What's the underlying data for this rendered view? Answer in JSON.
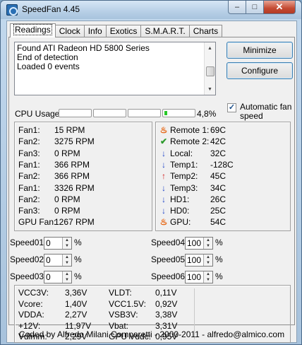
{
  "window": {
    "title": "SpeedFan 4.45",
    "min": "–",
    "max": "□",
    "close": "✕"
  },
  "tabs": [
    "Readings",
    "Clock",
    "Info",
    "Exotics",
    "S.M.A.R.T.",
    "Charts"
  ],
  "log": {
    "lines": [
      "Found ATI Radeon HD 5800 Series",
      "End of detection",
      "Loaded 0 events"
    ]
  },
  "buttons": {
    "minimize": "Minimize",
    "configure": "Configure"
  },
  "auto_fan": {
    "label": "Automatic fan speed",
    "checked": true,
    "mark": "✓"
  },
  "cpu_usage": {
    "label": "CPU Usage",
    "value": "4,8%",
    "fill_fraction": 0.048
  },
  "fans": [
    {
      "label": "Fan1:",
      "value": "15 RPM"
    },
    {
      "label": "Fan2:",
      "value": "3275 RPM"
    },
    {
      "label": "Fan3:",
      "value": "0 RPM"
    },
    {
      "label": "Fan1:",
      "value": "366 RPM"
    },
    {
      "label": "Fan2:",
      "value": "366 RPM"
    },
    {
      "label": "Fan1:",
      "value": "3326 RPM"
    },
    {
      "label": "Fan2:",
      "value": "0 RPM"
    },
    {
      "label": "Fan3:",
      "value": "0 RPM"
    },
    {
      "label": "GPU Fan:",
      "value": "1267 RPM"
    }
  ],
  "temps": [
    {
      "icon": "flame-icon",
      "glyph": "♨",
      "label": "Remote 1:",
      "value": "69C"
    },
    {
      "icon": "check-icon",
      "glyph": "✔",
      "label": "Remote 2:",
      "value": "42C"
    },
    {
      "icon": "down-arrow-icon",
      "glyph": "↓",
      "label": "Local:",
      "value": "32C"
    },
    {
      "icon": "down-arrow-icon",
      "glyph": "↓",
      "label": "Temp1:",
      "value": "-128C"
    },
    {
      "icon": "up-arrow-icon",
      "glyph": "↑",
      "label": "Temp2:",
      "value": "45C"
    },
    {
      "icon": "down-arrow-icon",
      "glyph": "↓",
      "label": "Temp3:",
      "value": "34C"
    },
    {
      "icon": "down-arrow-icon",
      "glyph": "↓",
      "label": "HD1:",
      "value": "26C"
    },
    {
      "icon": "down-arrow-icon",
      "glyph": "↓",
      "label": "HD0:",
      "value": "25C"
    },
    {
      "icon": "flame-icon",
      "glyph": "♨",
      "label": "GPU:",
      "value": "54C"
    }
  ],
  "speeds": [
    {
      "label": "Speed01:",
      "value": "0",
      "pct": "%"
    },
    {
      "label": "Speed02:",
      "value": "0",
      "pct": "%"
    },
    {
      "label": "Speed03:",
      "value": "0",
      "pct": "%"
    },
    {
      "label": "Speed04:",
      "value": "100",
      "pct": "%"
    },
    {
      "label": "Speed05:",
      "value": "100",
      "pct": "%"
    },
    {
      "label": "Speed06:",
      "value": "100",
      "pct": "%"
    }
  ],
  "voltages_left": [
    {
      "label": "VCC3V:",
      "value": "3,36V"
    },
    {
      "label": "Vcore:",
      "value": "1,40V"
    },
    {
      "label": "VDDA:",
      "value": "2,27V"
    },
    {
      "label": "+12V:",
      "value": "11,97V"
    },
    {
      "label": "Vdimm:",
      "value": "2,29V"
    }
  ],
  "voltages_right": [
    {
      "label": "VLDT:",
      "value": "0,11V"
    },
    {
      "label": "VCC1.5V:",
      "value": "0,92V"
    },
    {
      "label": "VSB3V:",
      "value": "3,38V"
    },
    {
      "label": "Vbat:",
      "value": "3,31V"
    },
    {
      "label": "GPU Vddc:",
      "value": "0,95V"
    }
  ],
  "footer": "Coded by Alfredo Milani Comparetti - 2000-2011 - alfredo@almico.com"
}
